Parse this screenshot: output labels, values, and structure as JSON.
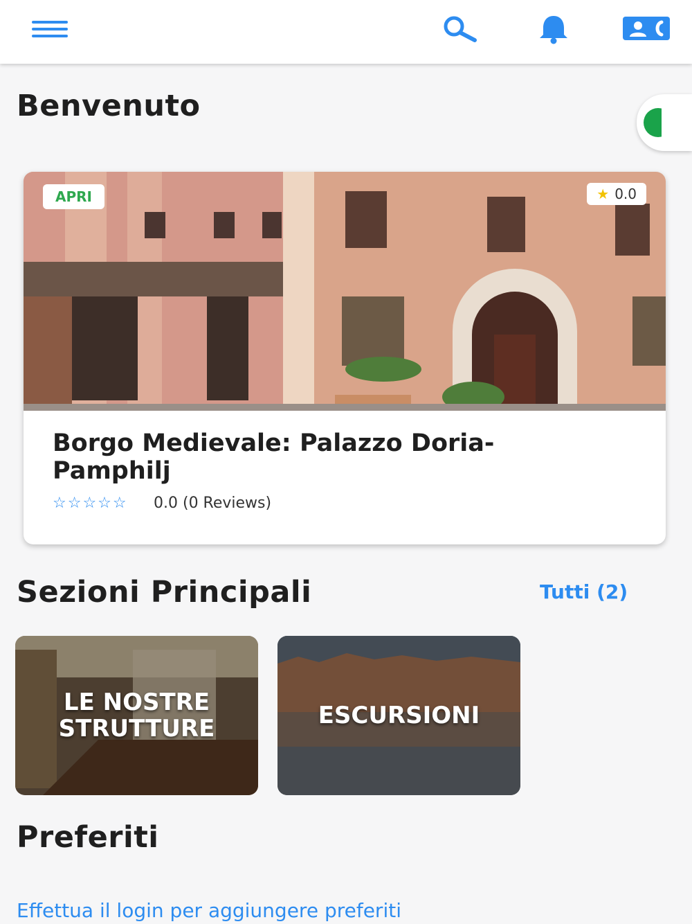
{
  "header": {
    "icons": [
      "menu-icon",
      "search-icon",
      "bell-icon",
      "contact-card-icon"
    ],
    "accent_color": "#2d8cf0"
  },
  "welcome": {
    "title": "Benvenuto"
  },
  "featured": {
    "status_badge": "APRI",
    "rating_badge": "0.0",
    "title": "Borgo Medievale: Palazzo Doria-Pamphilj",
    "stars": "☆☆☆☆☆",
    "reviews_text": "0.0 (0 Reviews)",
    "rating": 0.0,
    "status_color": "#2fa84f"
  },
  "sections": {
    "title": "Sezioni Principali",
    "see_all": "Tutti (2)",
    "items": [
      {
        "label": "LE NOSTRE STRUTTURE"
      },
      {
        "label": "ESCURSIONI"
      }
    ]
  },
  "favorites": {
    "title": "Preferiti",
    "login_prompt": "Effettua il login per aggiungere preferiti"
  }
}
